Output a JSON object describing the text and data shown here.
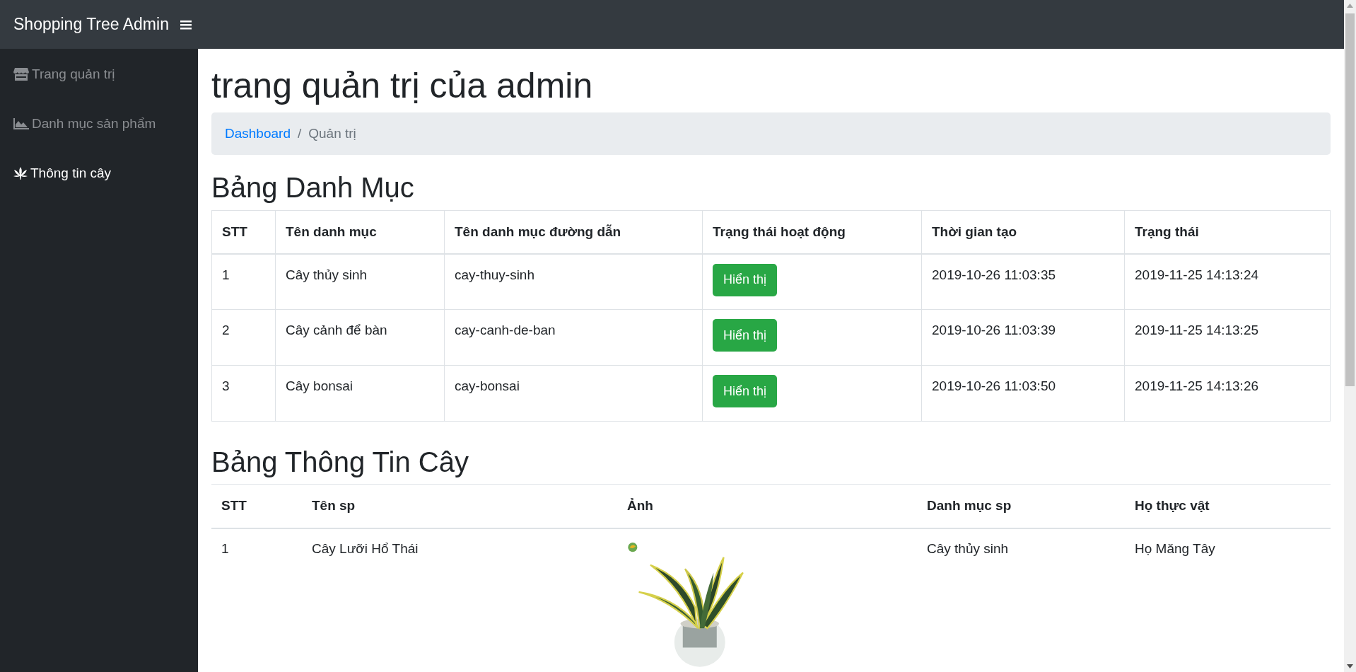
{
  "navbar": {
    "brand": "Shopping Tree Admin"
  },
  "sidebar": {
    "items": [
      {
        "label": "Trang quản trị",
        "selected": false
      },
      {
        "label": "Danh mục sản phẩm",
        "selected": false
      },
      {
        "label": "Thông tin cây",
        "selected": true
      }
    ]
  },
  "page_title": "trang quản trị của admin",
  "breadcrumb": [
    {
      "label": "Dashboard",
      "kind": "link"
    },
    {
      "label": "/",
      "kind": "separator"
    },
    {
      "label": "Quản trị",
      "kind": "current"
    }
  ],
  "category_table": {
    "title": "Bảng Danh Mục",
    "columns": [
      "STT",
      "Tên danh mục",
      "Tên danh mục đường dẫn",
      "Trạng thái hoạt động",
      "Thời gian tạo",
      "Trạng thái"
    ],
    "rows": [
      {
        "stt": "1",
        "name": "Cây thủy sinh",
        "slug": "cay-thuy-sinh",
        "action": "Hiển thị",
        "created": "2019-10-26 11:03:35",
        "status": "2019-11-25 14:13:24"
      },
      {
        "stt": "2",
        "name": "Cây cảnh để bàn",
        "slug": "cay-canh-de-ban",
        "action": "Hiển thị",
        "created": "2019-10-26 11:03:39",
        "status": "2019-11-25 14:13:25"
      },
      {
        "stt": "3",
        "name": "Cây bonsai",
        "slug": "cay-bonsai",
        "action": "Hiển thị",
        "created": "2019-10-26 11:03:50",
        "status": "2019-11-25 14:13:26"
      }
    ]
  },
  "tree_table": {
    "title": "Bảng Thông Tin Cây",
    "columns": [
      "STT",
      "Tên sp",
      "Ảnh",
      "Danh mục sp",
      "Họ thực vật"
    ],
    "rows": [
      {
        "stt": "1",
        "name": "Cây Lưỡi Hổ Thái",
        "category": "Cây thủy sinh",
        "family": "Họ Măng Tây"
      }
    ]
  }
}
